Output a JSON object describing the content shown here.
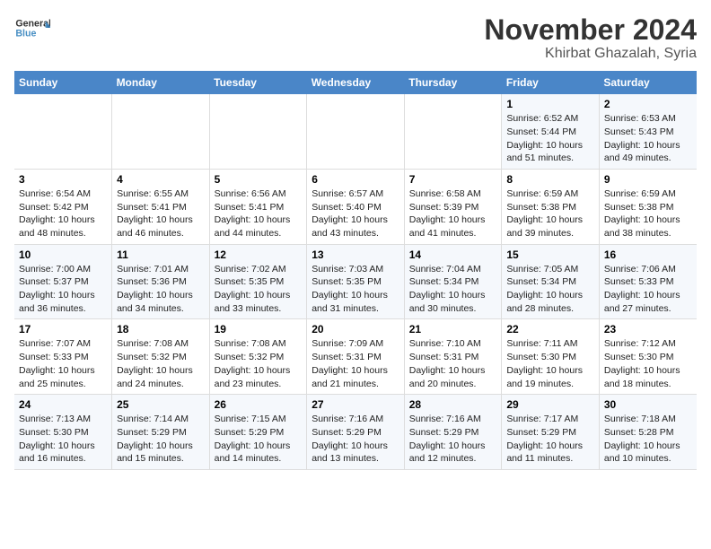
{
  "logo": {
    "general": "General",
    "blue": "Blue",
    "tagline": ""
  },
  "title": "November 2024",
  "subtitle": "Khirbat Ghazalah, Syria",
  "days_header": [
    "Sunday",
    "Monday",
    "Tuesday",
    "Wednesday",
    "Thursday",
    "Friday",
    "Saturday"
  ],
  "weeks": [
    [
      {
        "day": "",
        "info": ""
      },
      {
        "day": "",
        "info": ""
      },
      {
        "day": "",
        "info": ""
      },
      {
        "day": "",
        "info": ""
      },
      {
        "day": "",
        "info": ""
      },
      {
        "day": "1",
        "info": "Sunrise: 6:52 AM\nSunset: 5:44 PM\nDaylight: 10 hours and 51 minutes."
      },
      {
        "day": "2",
        "info": "Sunrise: 6:53 AM\nSunset: 5:43 PM\nDaylight: 10 hours and 49 minutes."
      }
    ],
    [
      {
        "day": "3",
        "info": "Sunrise: 6:54 AM\nSunset: 5:42 PM\nDaylight: 10 hours and 48 minutes."
      },
      {
        "day": "4",
        "info": "Sunrise: 6:55 AM\nSunset: 5:41 PM\nDaylight: 10 hours and 46 minutes."
      },
      {
        "day": "5",
        "info": "Sunrise: 6:56 AM\nSunset: 5:41 PM\nDaylight: 10 hours and 44 minutes."
      },
      {
        "day": "6",
        "info": "Sunrise: 6:57 AM\nSunset: 5:40 PM\nDaylight: 10 hours and 43 minutes."
      },
      {
        "day": "7",
        "info": "Sunrise: 6:58 AM\nSunset: 5:39 PM\nDaylight: 10 hours and 41 minutes."
      },
      {
        "day": "8",
        "info": "Sunrise: 6:59 AM\nSunset: 5:38 PM\nDaylight: 10 hours and 39 minutes."
      },
      {
        "day": "9",
        "info": "Sunrise: 6:59 AM\nSunset: 5:38 PM\nDaylight: 10 hours and 38 minutes."
      }
    ],
    [
      {
        "day": "10",
        "info": "Sunrise: 7:00 AM\nSunset: 5:37 PM\nDaylight: 10 hours and 36 minutes."
      },
      {
        "day": "11",
        "info": "Sunrise: 7:01 AM\nSunset: 5:36 PM\nDaylight: 10 hours and 34 minutes."
      },
      {
        "day": "12",
        "info": "Sunrise: 7:02 AM\nSunset: 5:35 PM\nDaylight: 10 hours and 33 minutes."
      },
      {
        "day": "13",
        "info": "Sunrise: 7:03 AM\nSunset: 5:35 PM\nDaylight: 10 hours and 31 minutes."
      },
      {
        "day": "14",
        "info": "Sunrise: 7:04 AM\nSunset: 5:34 PM\nDaylight: 10 hours and 30 minutes."
      },
      {
        "day": "15",
        "info": "Sunrise: 7:05 AM\nSunset: 5:34 PM\nDaylight: 10 hours and 28 minutes."
      },
      {
        "day": "16",
        "info": "Sunrise: 7:06 AM\nSunset: 5:33 PM\nDaylight: 10 hours and 27 minutes."
      }
    ],
    [
      {
        "day": "17",
        "info": "Sunrise: 7:07 AM\nSunset: 5:33 PM\nDaylight: 10 hours and 25 minutes."
      },
      {
        "day": "18",
        "info": "Sunrise: 7:08 AM\nSunset: 5:32 PM\nDaylight: 10 hours and 24 minutes."
      },
      {
        "day": "19",
        "info": "Sunrise: 7:08 AM\nSunset: 5:32 PM\nDaylight: 10 hours and 23 minutes."
      },
      {
        "day": "20",
        "info": "Sunrise: 7:09 AM\nSunset: 5:31 PM\nDaylight: 10 hours and 21 minutes."
      },
      {
        "day": "21",
        "info": "Sunrise: 7:10 AM\nSunset: 5:31 PM\nDaylight: 10 hours and 20 minutes."
      },
      {
        "day": "22",
        "info": "Sunrise: 7:11 AM\nSunset: 5:30 PM\nDaylight: 10 hours and 19 minutes."
      },
      {
        "day": "23",
        "info": "Sunrise: 7:12 AM\nSunset: 5:30 PM\nDaylight: 10 hours and 18 minutes."
      }
    ],
    [
      {
        "day": "24",
        "info": "Sunrise: 7:13 AM\nSunset: 5:30 PM\nDaylight: 10 hours and 16 minutes."
      },
      {
        "day": "25",
        "info": "Sunrise: 7:14 AM\nSunset: 5:29 PM\nDaylight: 10 hours and 15 minutes."
      },
      {
        "day": "26",
        "info": "Sunrise: 7:15 AM\nSunset: 5:29 PM\nDaylight: 10 hours and 14 minutes."
      },
      {
        "day": "27",
        "info": "Sunrise: 7:16 AM\nSunset: 5:29 PM\nDaylight: 10 hours and 13 minutes."
      },
      {
        "day": "28",
        "info": "Sunrise: 7:16 AM\nSunset: 5:29 PM\nDaylight: 10 hours and 12 minutes."
      },
      {
        "day": "29",
        "info": "Sunrise: 7:17 AM\nSunset: 5:29 PM\nDaylight: 10 hours and 11 minutes."
      },
      {
        "day": "30",
        "info": "Sunrise: 7:18 AM\nSunset: 5:28 PM\nDaylight: 10 hours and 10 minutes."
      }
    ]
  ]
}
